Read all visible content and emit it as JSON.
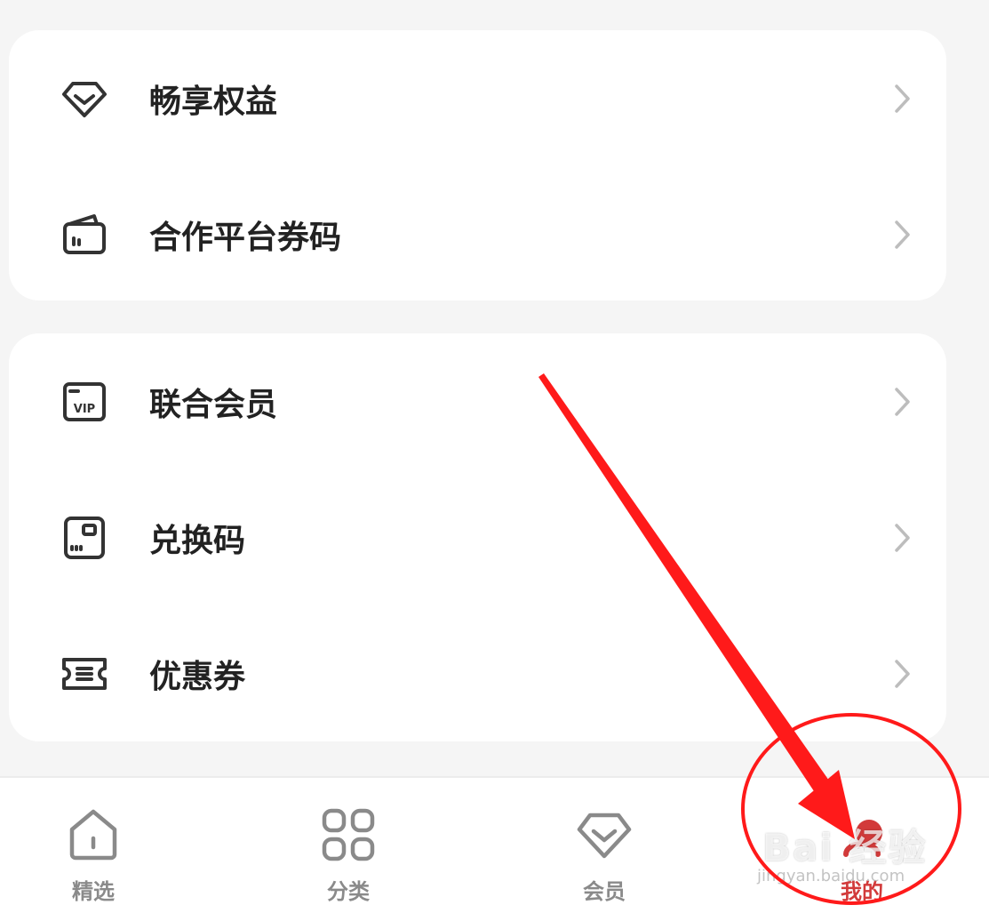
{
  "menu": {
    "group1": [
      {
        "label": "畅享权益",
        "icon": "diamond-icon"
      },
      {
        "label": "合作平台券码",
        "icon": "wallet-icon"
      }
    ],
    "group2": [
      {
        "label": "联合会员",
        "icon": "vip-card-icon"
      },
      {
        "label": "兑换码",
        "icon": "redeem-card-icon"
      },
      {
        "label": "优惠券",
        "icon": "coupon-icon"
      }
    ]
  },
  "tabbar": {
    "tabs": [
      {
        "label": "精选",
        "icon": "home-icon",
        "active": false
      },
      {
        "label": "分类",
        "icon": "grid-icon",
        "active": false
      },
      {
        "label": "会员",
        "icon": "diamond-icon",
        "active": false
      },
      {
        "label": "我的",
        "icon": "profile-icon",
        "active": true
      }
    ]
  },
  "annotation": {
    "watermark_text": "Bai 经验",
    "watermark_subtext": "jingyan.baidu.com",
    "color": "#ff1a1a"
  },
  "colors": {
    "active_tab": "#d23a3a",
    "inactive_tab": "#8a8a8a",
    "background": "#f5f5f5"
  }
}
